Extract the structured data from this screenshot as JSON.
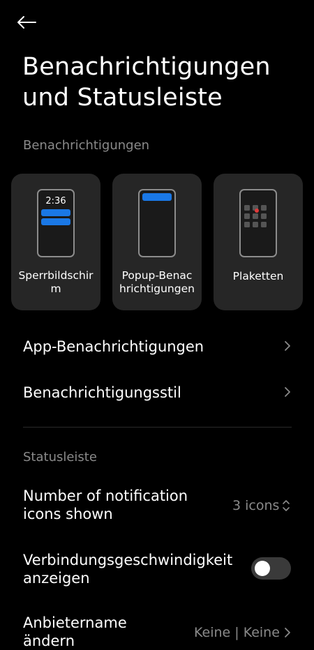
{
  "header": {
    "title_line1": "Benachrichtigungen",
    "title_line2": "und Statusleiste"
  },
  "sections": {
    "notifications_label": "Benachrichtigungen",
    "statusbar_label": "Statusleiste"
  },
  "cards": [
    {
      "label_line1": "Sperrbildschir",
      "label_line2": "m",
      "preview_time": "2:36"
    },
    {
      "label_line1": "Popup-Benac",
      "label_line2": "hrichtigungen"
    },
    {
      "label_line1": "Plaketten",
      "label_line2": ""
    }
  ],
  "rows": {
    "app_notifications": "App-Benachrichtigungen",
    "notification_style": "Benachrichtigungsstil",
    "notif_icons_line1": "Number of notification",
    "notif_icons_line2": "icons shown",
    "notif_icons_value": "3 icons",
    "speed_line1": "Verbindungsgeschwindigkeit",
    "speed_line2": "anzeigen",
    "carrier_line1": "Anbietername",
    "carrier_line2": "ändern",
    "carrier_value": "Keine | Keine"
  },
  "toggles": {
    "connection_speed_on": false
  },
  "colors": {
    "background": "#000000",
    "card": "#262626",
    "accent_blue": "#1a78e6",
    "badge_red": "#e03a3a",
    "secondary_text": "#8a8a8a"
  },
  "icons": {
    "back": "arrow-left-icon",
    "chevron": "chevron-right-icon",
    "updown": "chevron-updown-icon"
  }
}
